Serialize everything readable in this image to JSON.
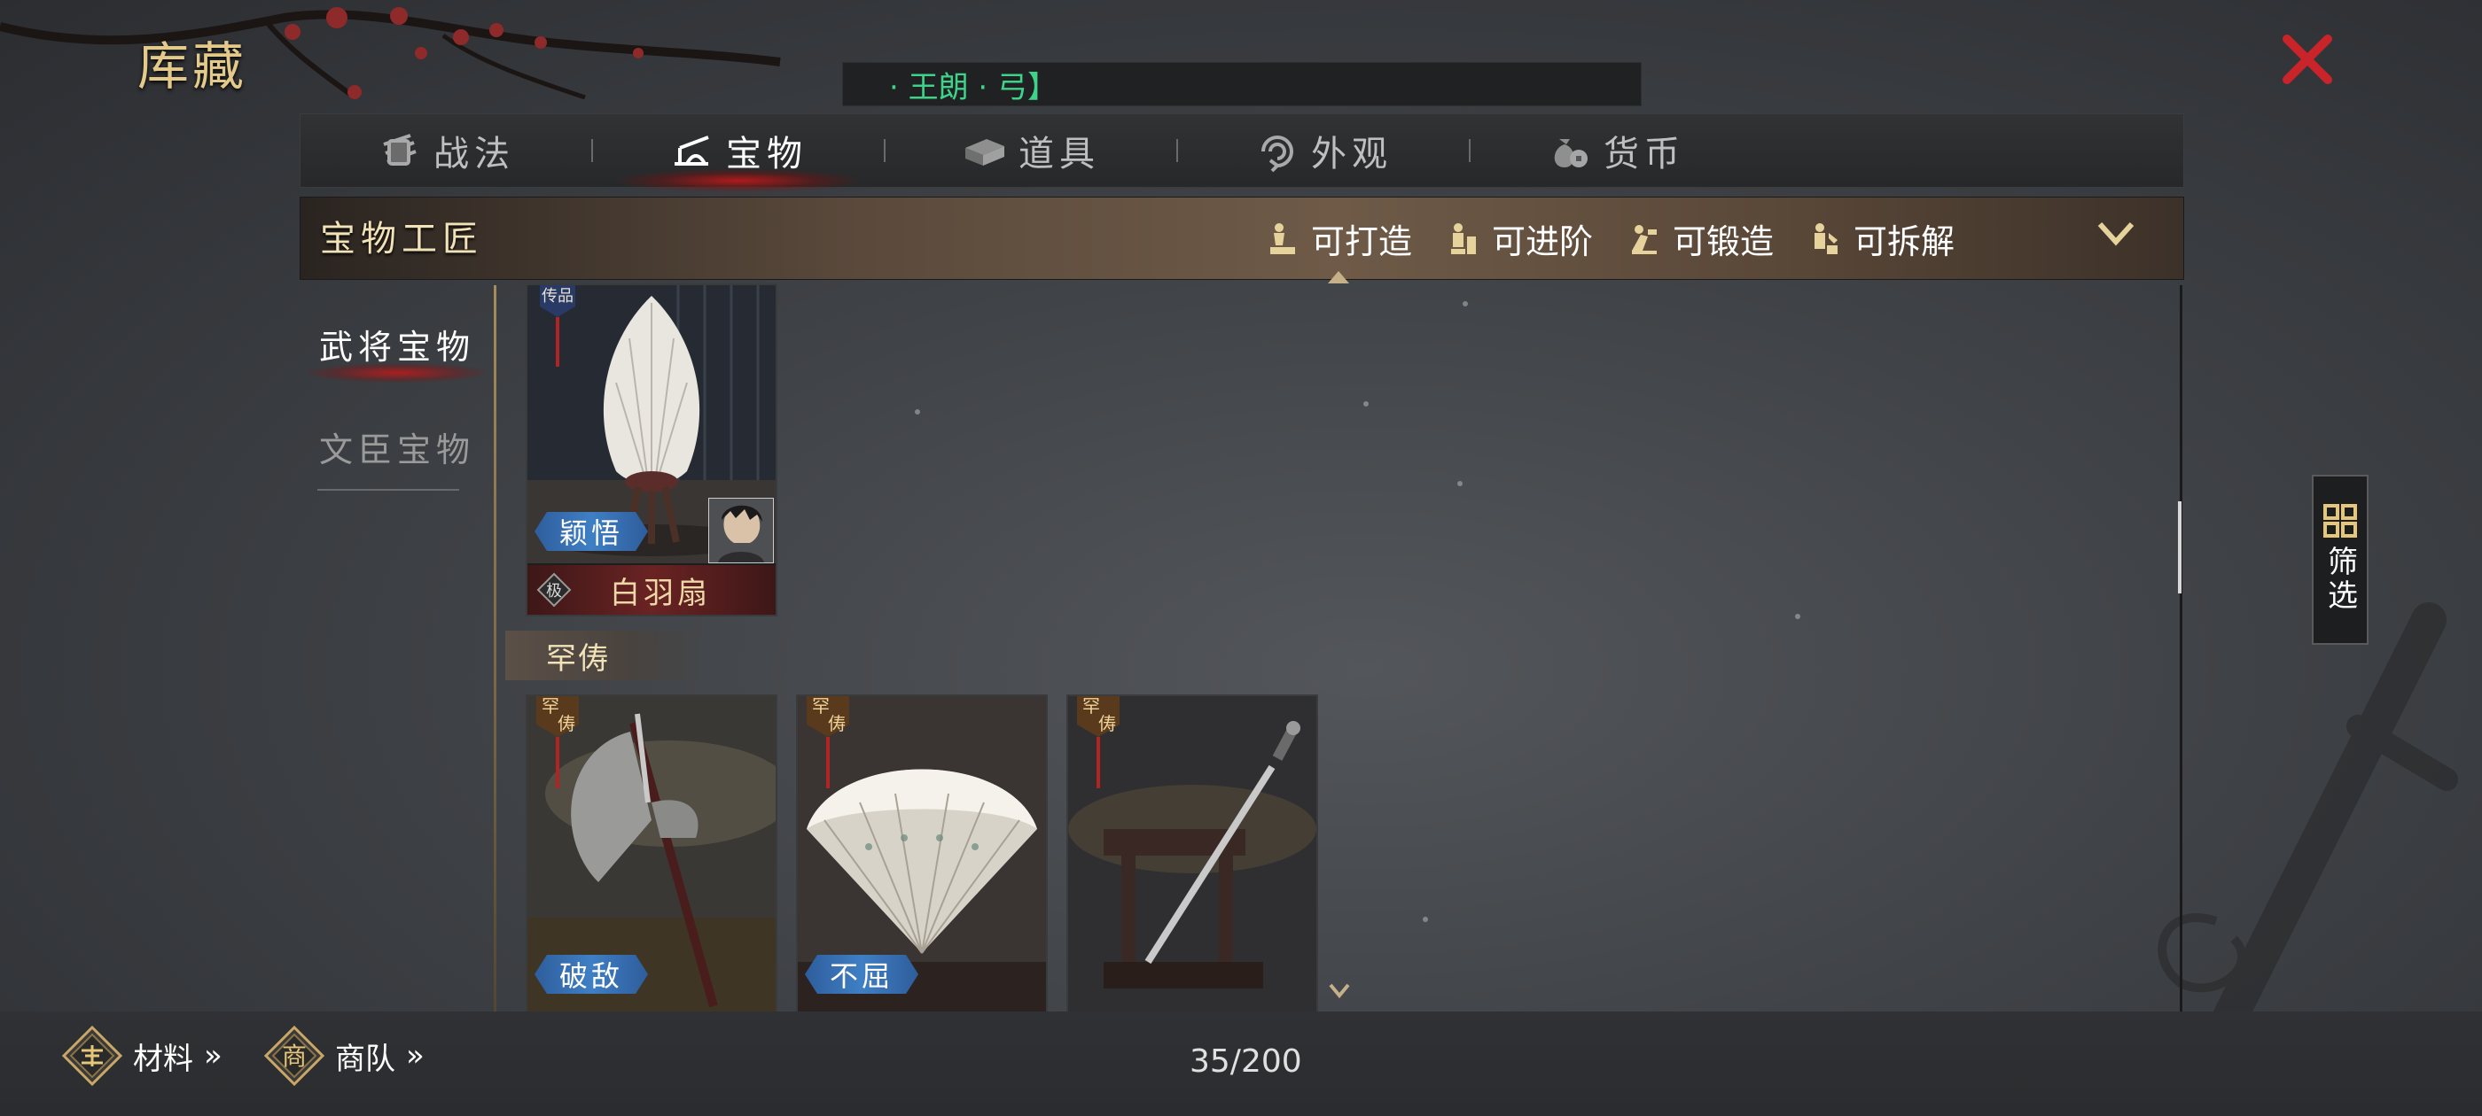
{
  "header": {
    "title": "库藏",
    "marquee_text": "· 王朗 · 弓】"
  },
  "tabs": [
    {
      "label": "战法",
      "icon": "scroll-bundle-icon",
      "active": false
    },
    {
      "label": "宝物",
      "icon": "treasure-bridge-icon",
      "active": true
    },
    {
      "label": "道具",
      "icon": "box-icon",
      "active": false
    },
    {
      "label": "外观",
      "icon": "swirl-icon",
      "active": false
    },
    {
      "label": "货币",
      "icon": "money-bag-icon",
      "active": false
    }
  ],
  "craftsman": {
    "title": "宝物工匠",
    "actions": [
      {
        "label": "可打造",
        "icon": "forge-anvil-icon"
      },
      {
        "label": "可进阶",
        "icon": "advance-icon"
      },
      {
        "label": "可锻造",
        "icon": "hammer-icon"
      },
      {
        "label": "可拆解",
        "icon": "dismantle-icon"
      }
    ]
  },
  "categories": [
    {
      "label": "武将宝物",
      "active": true
    },
    {
      "label": "文臣宝物",
      "active": false
    }
  ],
  "top_card": {
    "rarity": "传品",
    "skill": "颖悟",
    "grade_icon": "极",
    "name": "白羽扇",
    "has_hero_portrait": true
  },
  "section": {
    "label": "罕俦"
  },
  "cards": [
    {
      "rarity": "罕俦",
      "skill": "破敌",
      "art": "axe"
    },
    {
      "rarity": "罕俦",
      "skill": "不屈",
      "art": "feather-fan"
    },
    {
      "rarity": "罕俦",
      "skill": "",
      "art": "sword-on-stand"
    }
  ],
  "filter": {
    "label": "筛选"
  },
  "bottom": {
    "materials_label": "材料",
    "materials_icon": "materials-badge-icon",
    "caravan_label": "商队",
    "caravan_icon": "merchant-badge-icon",
    "arrows": "»",
    "counter": "35/200"
  },
  "colors": {
    "tab_active_glow": "#be1919",
    "skill_tag": "#3f7fc4",
    "name_bar": "#6a2323",
    "title_gold": "#e3c98a",
    "marquee_green": "#3fd38a",
    "close_red": "#c8242a"
  }
}
